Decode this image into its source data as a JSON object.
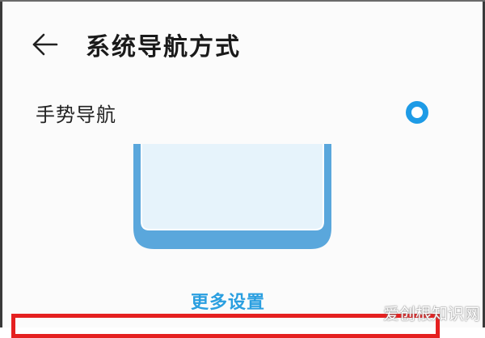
{
  "header": {
    "title": "系统导航方式",
    "back_icon": "arrow-left-icon"
  },
  "gesture_option": {
    "label": "手势导航",
    "selected": true,
    "accent_color": "#1e9be6"
  },
  "preview": {
    "icon": "phone-outline-preview"
  },
  "more_settings": {
    "label": "更多设置",
    "color": "#2a9fe0"
  },
  "highlight": {
    "color": "#e52020"
  },
  "watermark": {
    "text": "爱创根知识网"
  }
}
